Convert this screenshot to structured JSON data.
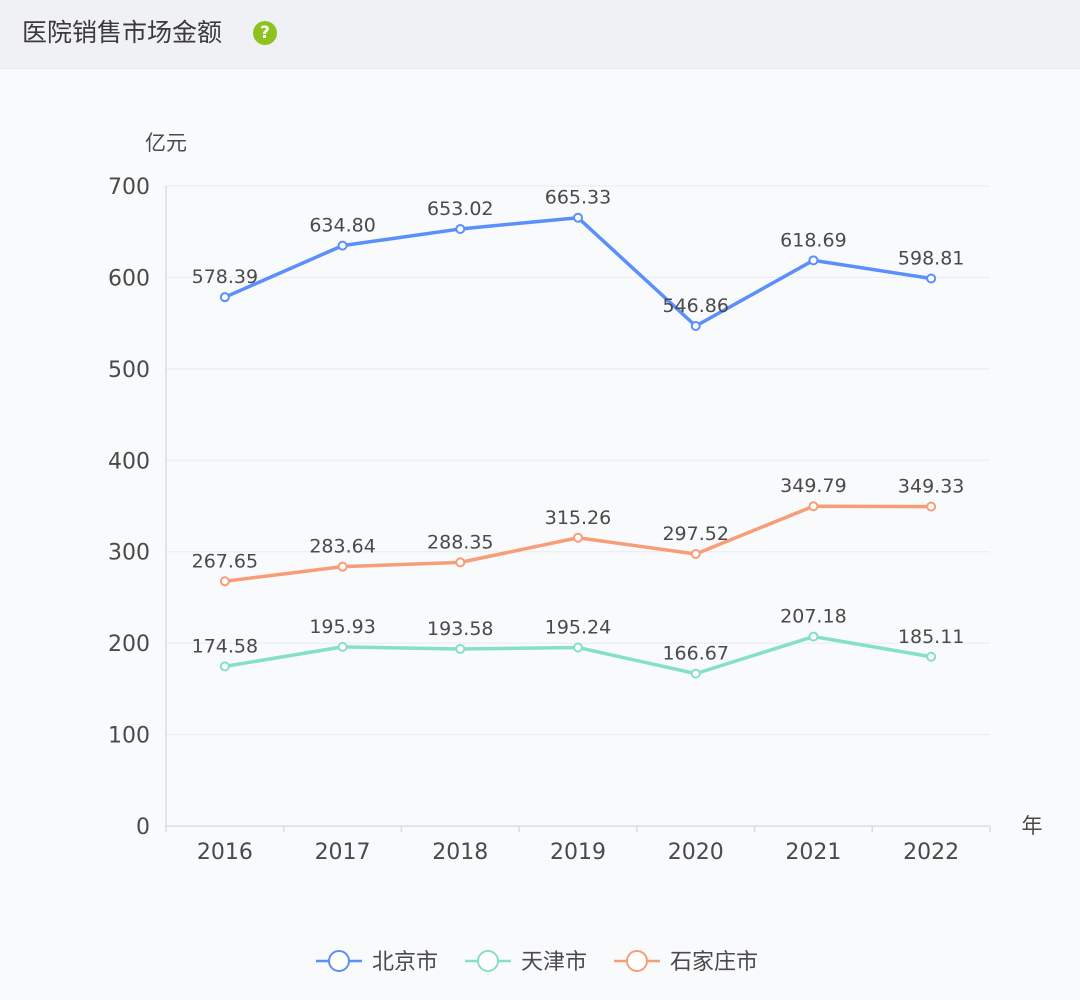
{
  "header": {
    "title": "医院销售市场金额",
    "help_icon": "question-circle-icon"
  },
  "chart_data": {
    "type": "line",
    "title": "医院销售市场金额",
    "ylabel": "亿元",
    "xlabel": "年",
    "ylim": [
      0,
      700
    ],
    "yticks": [
      0,
      100,
      200,
      300,
      400,
      500,
      600,
      700
    ],
    "categories": [
      "2016",
      "2017",
      "2018",
      "2019",
      "2020",
      "2021",
      "2022"
    ],
    "grid": true,
    "legend_position": "bottom",
    "series": [
      {
        "name": "北京市",
        "color": "#5b8ff9",
        "values": [
          578.39,
          634.8,
          653.02,
          665.33,
          546.86,
          618.69,
          598.81
        ],
        "labels": [
          "578.39",
          "634.80",
          "653.02",
          "665.33",
          "546.86",
          "618.69",
          "598.81"
        ]
      },
      {
        "name": "天津市",
        "color": "#86e0c3",
        "values": [
          174.58,
          195.93,
          193.58,
          195.24,
          166.67,
          207.18,
          185.11
        ],
        "labels": [
          "174.58",
          "195.93",
          "193.58",
          "195.24",
          "166.67",
          "207.18",
          "185.11"
        ]
      },
      {
        "name": "石家庄市",
        "color": "#f79e78",
        "values": [
          267.65,
          283.64,
          288.35,
          315.26,
          297.52,
          349.79,
          349.33
        ],
        "labels": [
          "267.65",
          "283.64",
          "288.35",
          "315.26",
          "297.52",
          "349.79",
          "349.33"
        ]
      }
    ]
  }
}
